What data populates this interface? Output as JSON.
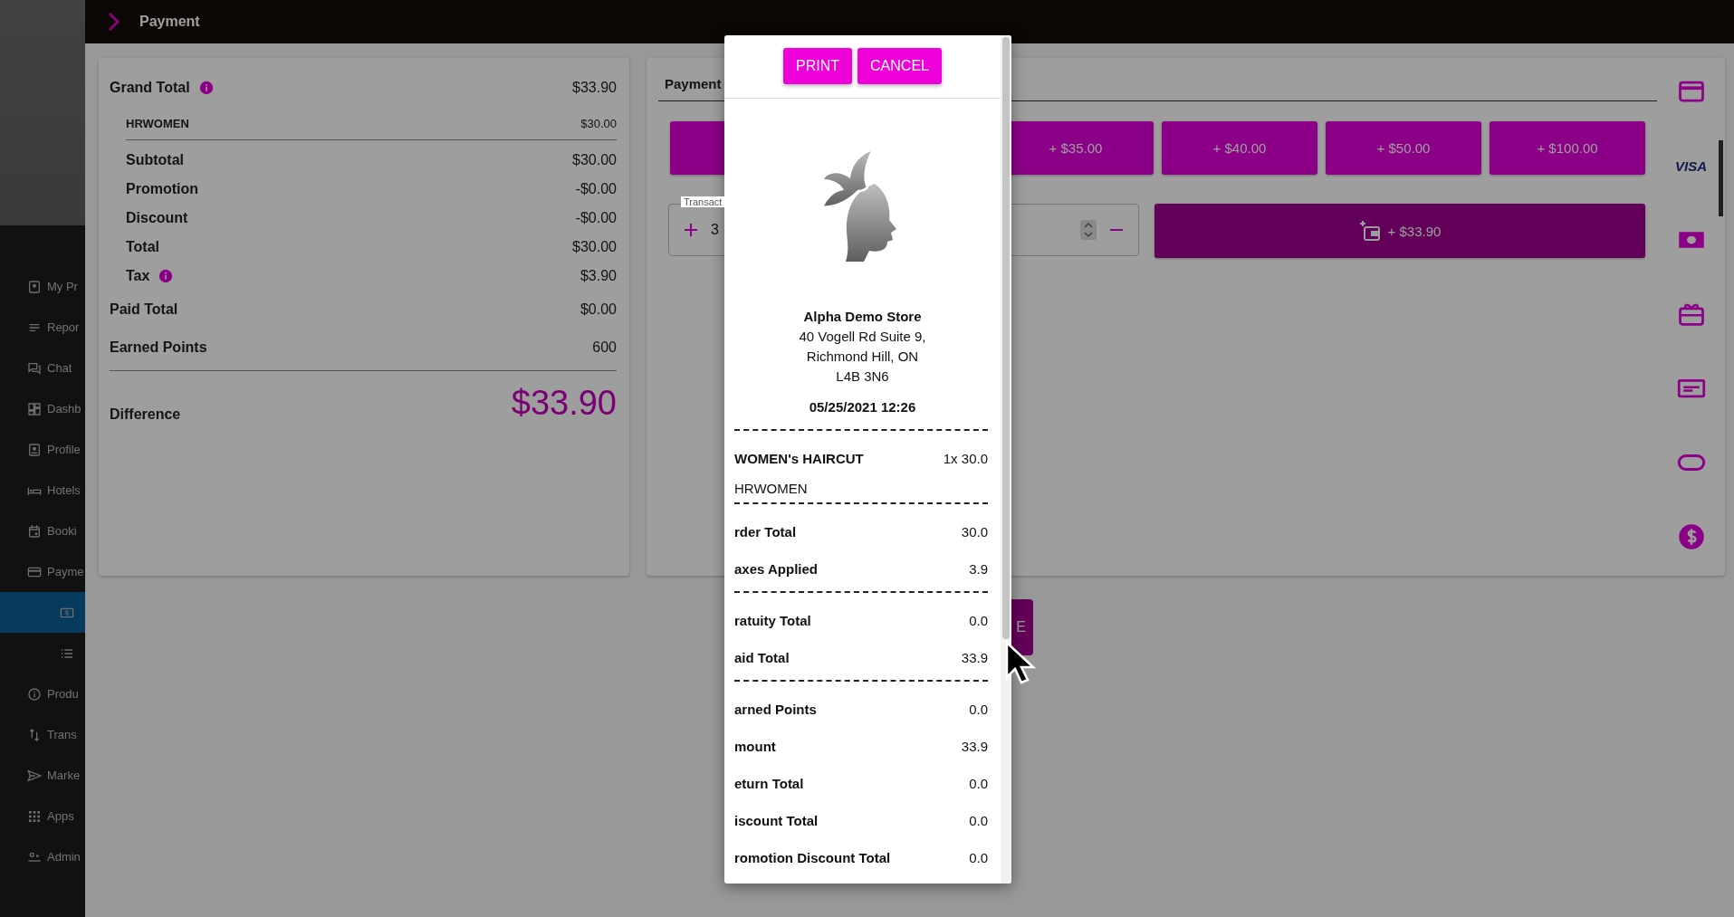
{
  "sidebar": {
    "items": [
      {
        "label": "My Pr",
        "selected": false
      },
      {
        "label": "Repor",
        "selected": false
      },
      {
        "label": "Chat",
        "selected": false
      },
      {
        "label": "Dashb",
        "selected": false
      },
      {
        "label": "Profile",
        "selected": false
      },
      {
        "label": "Hotels",
        "selected": false
      },
      {
        "label": "Booki",
        "selected": false
      },
      {
        "label": "Payme",
        "selected": false,
        "children": [
          {
            "selected": true
          },
          {
            "selected": false
          }
        ]
      },
      {
        "label": "Produ",
        "selected": false
      },
      {
        "label": "Trans",
        "selected": false
      },
      {
        "label": "Marke",
        "selected": false
      },
      {
        "label": "Apps",
        "selected": false
      },
      {
        "label": "Admin",
        "selected": false
      }
    ]
  },
  "top_bar": {
    "title": "Payment"
  },
  "summary": {
    "rows": [
      {
        "kind": "main",
        "label": "Grand Total",
        "value": "$33.90",
        "info": true
      },
      {
        "kind": "item",
        "label": "HRWOMEN",
        "value": "$30.00",
        "info": false
      },
      {
        "kind": "sub",
        "label": "Subtotal",
        "value": "$30.00",
        "info": false
      },
      {
        "kind": "sub",
        "label": "Promotion",
        "value": "-$0.00",
        "info": false
      },
      {
        "kind": "sub",
        "label": "Discount",
        "value": "-$0.00",
        "info": false
      },
      {
        "kind": "sub",
        "label": "Total",
        "value": "$30.00",
        "info": false
      },
      {
        "kind": "sub",
        "label": "Tax",
        "value": "$3.90",
        "info": true
      },
      {
        "kind": "main",
        "label": "Paid Total",
        "value": "$0.00",
        "info": false
      },
      {
        "kind": "main",
        "label": "Earned Points",
        "value": "600",
        "info": false
      }
    ],
    "difference": {
      "label": "Difference",
      "value": "$33.90"
    }
  },
  "payment": {
    "tab": "Payment",
    "quick_amounts": [
      {
        "kind": "covered"
      },
      {
        "kind": "amount",
        "label": "+ $35.00"
      },
      {
        "kind": "amount",
        "label": "+ $40.00"
      },
      {
        "kind": "amount",
        "label": "+ $50.00"
      },
      {
        "kind": "amount",
        "label": "+ $100.00"
      }
    ],
    "transaction": {
      "label": "Transact",
      "value": "3"
    },
    "pay_button": "+ $33.90",
    "methods": [
      {
        "kind": "card"
      },
      {
        "kind": "visa",
        "label": "VISA"
      },
      {
        "kind": "cash"
      },
      {
        "kind": "gift"
      },
      {
        "kind": "card-alt"
      },
      {
        "kind": "oval"
      },
      {
        "kind": "dollar"
      }
    ],
    "bottom_button": "E"
  },
  "receipt": {
    "buttons": [
      "PRINT",
      "CANCEL"
    ],
    "store": "Alpha Demo Store",
    "address": [
      "40 Vogell Rd Suite 9,",
      "Richmond Hill, ON",
      "L4B 3N6"
    ],
    "date": "05/25/2021 12:26",
    "lines": [
      {
        "kind": "divider"
      },
      {
        "kind": "item",
        "label": "WOMEN's HAIRCUT",
        "value": "1x 30.0"
      },
      {
        "kind": "note",
        "label": "HRWOMEN"
      },
      {
        "kind": "divider"
      },
      {
        "kind": "row",
        "label": "rder Total",
        "value": "30.0"
      },
      {
        "kind": "row",
        "label": "axes Applied",
        "value": "3.9"
      },
      {
        "kind": "divider"
      },
      {
        "kind": "row",
        "label": "ratuity Total",
        "value": "0.0"
      },
      {
        "kind": "row",
        "label": "aid Total",
        "value": "33.9"
      },
      {
        "kind": "divider"
      },
      {
        "kind": "row",
        "label": "arned Points",
        "value": "0.0"
      },
      {
        "kind": "row",
        "label": "mount",
        "value": "33.9"
      },
      {
        "kind": "row",
        "label": "eturn Total",
        "value": "0.0"
      },
      {
        "kind": "row",
        "label": "iscount Total",
        "value": "0.0"
      },
      {
        "kind": "row",
        "label": "romotion Discount Total",
        "value": "0.0"
      }
    ]
  }
}
